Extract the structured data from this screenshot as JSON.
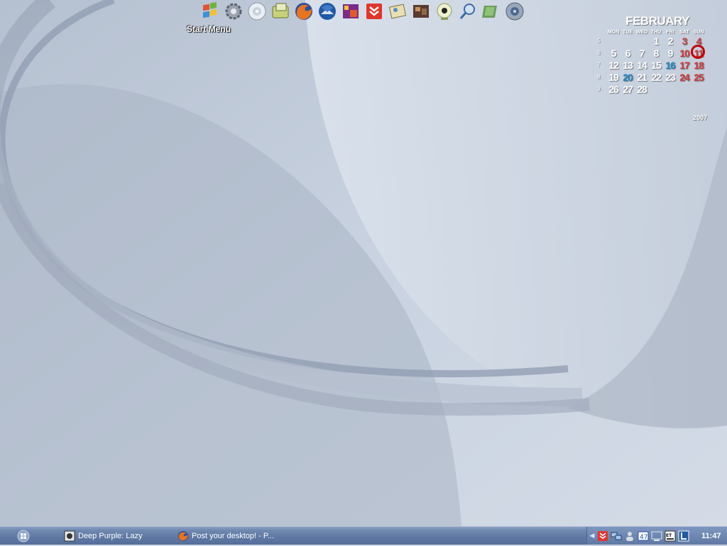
{
  "dock": {
    "label": "Start Menu",
    "items": [
      {
        "name": "start-menu-icon"
      },
      {
        "name": "settings-gear-icon"
      },
      {
        "name": "cd-drive-icon"
      },
      {
        "name": "folder-icon"
      },
      {
        "name": "firefox-icon"
      },
      {
        "name": "thunderbird-icon"
      },
      {
        "name": "media-player-icon"
      },
      {
        "name": "download-manager-icon"
      },
      {
        "name": "image-viewer-icon"
      },
      {
        "name": "photo-gallery-icon"
      },
      {
        "name": "webcam-icon"
      },
      {
        "name": "search-icon"
      },
      {
        "name": "notebook-icon"
      },
      {
        "name": "speaker-icon"
      }
    ]
  },
  "calendar": {
    "month": "FEBRUARY",
    "weekdays": [
      "MON",
      "TUE",
      "WED",
      "THU",
      "FRI",
      "SAT",
      "SUN"
    ],
    "weeks": [
      {
        "num": "5",
        "days": [
          "",
          "",
          "",
          "1",
          "2",
          "3",
          "4"
        ]
      },
      {
        "num": "6",
        "days": [
          "5",
          "6",
          "7",
          "8",
          "9",
          "10",
          "11"
        ]
      },
      {
        "num": "7",
        "days": [
          "12",
          "13",
          "14",
          "15",
          "16",
          "17",
          "18"
        ]
      },
      {
        "num": "8",
        "days": [
          "19",
          "20",
          "21",
          "22",
          "23",
          "24",
          "25"
        ]
      },
      {
        "num": "9",
        "days": [
          "26",
          "27",
          "28",
          "",
          "",
          "",
          ""
        ]
      }
    ],
    "highlight_blue": [
      "16",
      "20"
    ],
    "today": "11",
    "year": "2007",
    "colors": {
      "weekend": "#d23a3a",
      "highlight": "#1f86c2",
      "today_ring": "#c40000"
    }
  },
  "taskbar": {
    "tasks": [
      {
        "label": "Deep Purple: Lazy",
        "icon": "music-player-icon"
      },
      {
        "label": "Post your desktop! - P...",
        "icon": "firefox-icon"
      }
    ],
    "tray_icons": [
      "download-manager-icon",
      "network-icon",
      "user-icon",
      "keyboard-icon",
      "display-icon",
      "device-icon",
      "app-icon"
    ],
    "clock": "11:47"
  }
}
